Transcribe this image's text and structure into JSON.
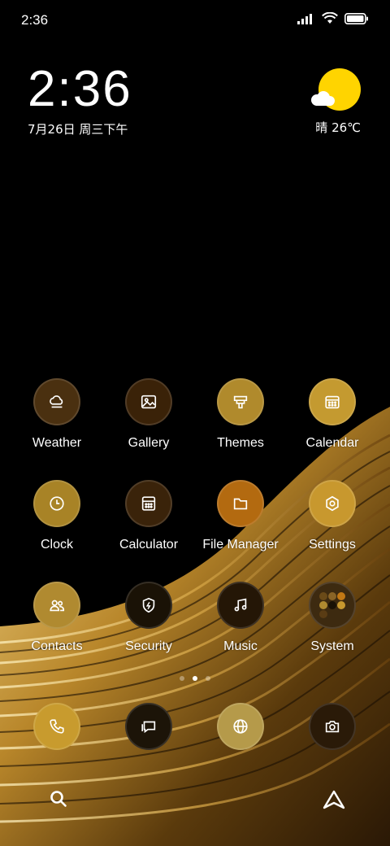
{
  "status_bar": {
    "time": "2:36"
  },
  "clock_widget": {
    "time": "2:36",
    "date": "7月26日 周三下午"
  },
  "weather_widget": {
    "condition_temp": "晴 26℃"
  },
  "apps": [
    {
      "label": "Weather",
      "icon": "weather-icon",
      "color": "#4a3010"
    },
    {
      "label": "Gallery",
      "icon": "gallery-icon",
      "color": "#3a2208"
    },
    {
      "label": "Themes",
      "icon": "themes-icon",
      "color": "#b08a2c"
    },
    {
      "label": "Calendar",
      "icon": "calendar-icon",
      "color": "#c49a30"
    },
    {
      "label": "Clock",
      "icon": "clock-icon",
      "color": "#a88326"
    },
    {
      "label": "Calculator",
      "icon": "calculator-icon",
      "color": "#3a230a"
    },
    {
      "label": "File Manager",
      "icon": "folder-icon",
      "color": "#b36a10"
    },
    {
      "label": "Settings",
      "icon": "settings-icon",
      "color": "#c8982e"
    },
    {
      "label": "Contacts",
      "icon": "contacts-icon",
      "color": "#b08a30"
    },
    {
      "label": "Security",
      "icon": "shield-icon",
      "color": "#1a1206"
    },
    {
      "label": "Music",
      "icon": "music-icon",
      "color": "#241606"
    },
    {
      "label": "System",
      "icon": "folder-grid-icon",
      "color": "#3d2a10"
    }
  ],
  "dock": [
    {
      "name": "phone-icon",
      "color": "#c89b2e"
    },
    {
      "name": "message-icon",
      "color": "#1c1408"
    },
    {
      "name": "browser-icon",
      "color": "#b59a4a"
    },
    {
      "name": "camera-icon",
      "color": "#2a1a08"
    }
  ],
  "bottom_bar": {
    "search_icon": "search-icon",
    "assistant_icon": "assistant-icon"
  }
}
